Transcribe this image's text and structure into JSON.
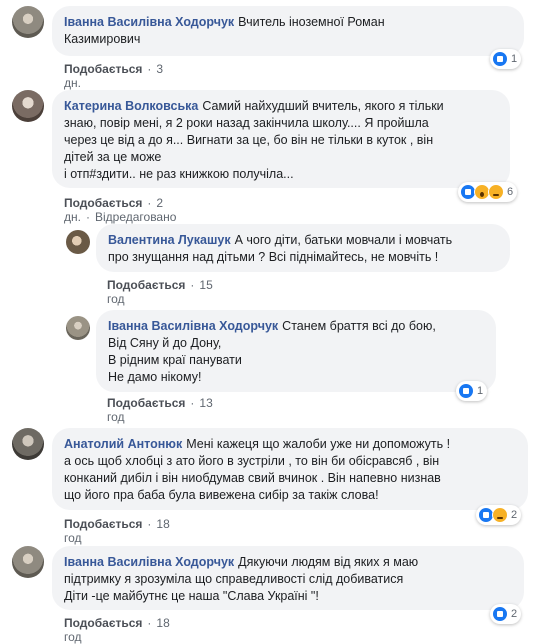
{
  "comments": [
    {
      "author": "Іванна Василівна Ходорчук",
      "text": "Вчитель іноземної Роман\nКазимирович",
      "like_label": "Подобається",
      "time": "3 дн.",
      "reactions": {
        "icons": [
          "like-icon"
        ],
        "count": "1"
      }
    },
    {
      "author": "Катерина Волковська",
      "text": "Самий найхудший вчитель, якого я тільки\nзнаю, повір мені, я 2 роки назад закінчила школу.... Я пройшла\nчерез це від а до я... Вигнати за це, бо він не тільки в куток , він\nдітей за це може\nі отп#здити.. не раз книжкою получіла...",
      "like_label": "Подобається",
      "time": "2 дн.",
      "edited": "Відредаговано",
      "reactions": {
        "icons": [
          "like-icon",
          "wow-icon",
          "sad-icon"
        ],
        "count": "6"
      }
    },
    {
      "author": "Валентина Лукашук",
      "text": "А чого діти, батьки мовчали і мовчать\nпро знущання над дітьми ? Всі піднімайтесь, не мовчіть !",
      "like_label": "Подобається",
      "time": "15 год"
    },
    {
      "author": "Іванна Василівна Ходорчук",
      "text": "Станем браття всі до бою,\nВід Сяну й до Дону,\nВ рідним краї панувати\nНе дамо нікому!",
      "like_label": "Подобається",
      "time": "13 год",
      "reactions": {
        "icons": [
          "like-icon"
        ],
        "count": "1"
      }
    },
    {
      "author": "Анатолий Антонюк",
      "text": "Мені кажеця що жалоби уже ни допоможуть !\nа ось щоб хлобці з ато його в зустріли , то він би обісравсяб , він\nконканий дибіл і він ниобдумав свий вчинок . Він напевно низнав\nщо його пра баба була вивежена сибір за такіж слова!",
      "like_label": "Подобається",
      "time": "18 год",
      "reactions": {
        "icons": [
          "like-icon",
          "sad-icon"
        ],
        "count": "2"
      }
    },
    {
      "author": "Іванна Василівна Ходорчук",
      "text": "Дякуючи людям від яких я маю\nпідтримку я зрозуміла що справедливості слід добиватися\nДіти -це майбутнє це наша \"Слава Україні \"!",
      "like_label": "Подобається",
      "time": "18 год",
      "reactions": {
        "icons": [
          "like-icon"
        ],
        "count": "2"
      }
    }
  ]
}
